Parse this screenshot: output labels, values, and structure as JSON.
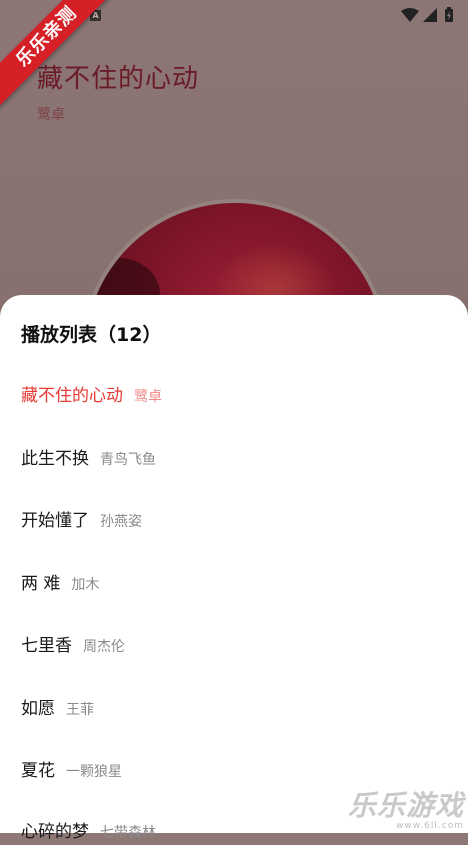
{
  "status_bar": {
    "notification_letter": "A"
  },
  "player": {
    "song_title": "藏不住的心动",
    "artist": "鹭卓"
  },
  "corner_badge": "乐乐亲测",
  "playlist": {
    "title": "播放列表（12）",
    "items": [
      {
        "name": "藏不住的心动",
        "artist": "鹭卓",
        "active": true
      },
      {
        "name": "此生不换",
        "artist": "青鸟飞鱼"
      },
      {
        "name": "开始懂了",
        "artist": "孙燕姿"
      },
      {
        "name": "两 难",
        "artist": "加木"
      },
      {
        "name": "七里香",
        "artist": "周杰伦"
      },
      {
        "name": "如愿",
        "artist": "王菲"
      },
      {
        "name": "夏花",
        "artist": "一颗狼星"
      },
      {
        "name": "心碎的梦",
        "artist": "七带森林"
      }
    ]
  },
  "watermark": {
    "main": "乐乐游戏",
    "sub": "www.6ll.com"
  },
  "colors": {
    "accent": "#e53935",
    "disc": "#7e1528"
  }
}
